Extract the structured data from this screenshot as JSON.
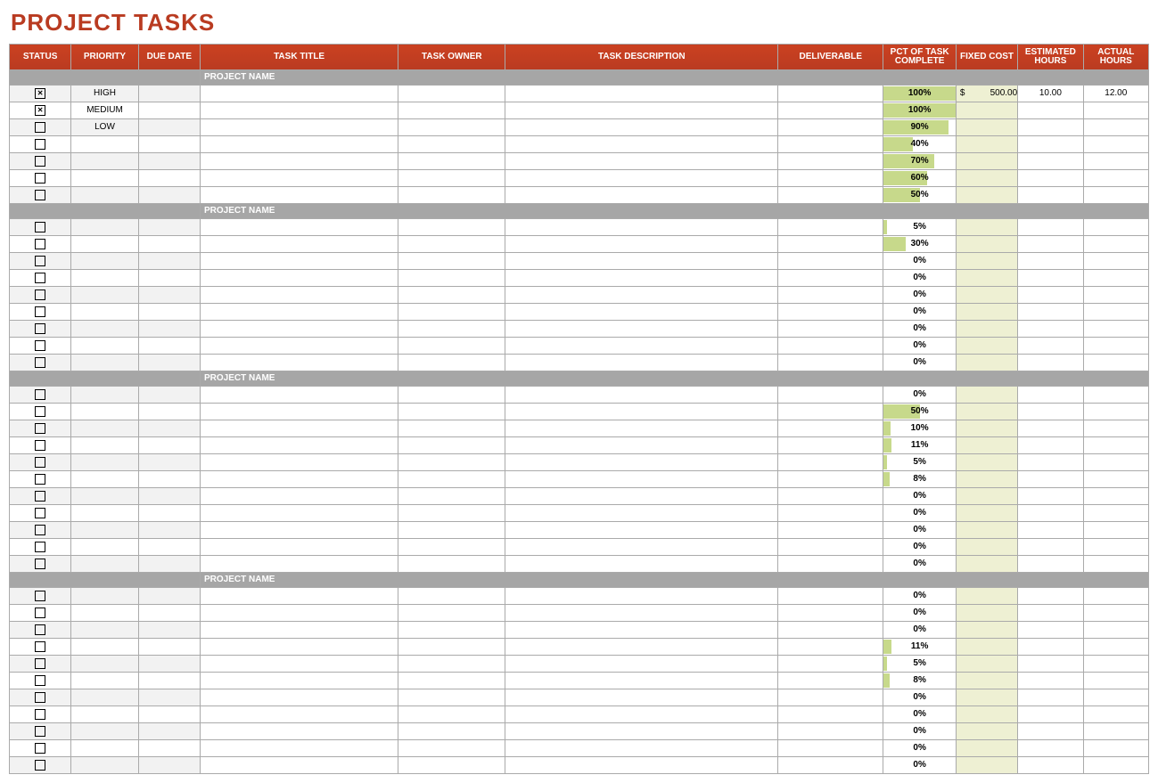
{
  "title": "PROJECT TASKS",
  "headers": {
    "status": "STATUS",
    "priority": "PRIORITY",
    "due_date": "DUE DATE",
    "task_title": "TASK TITLE",
    "task_owner": "TASK OWNER",
    "task_description": "TASK DESCRIPTION",
    "deliverable": "DELIVERABLE",
    "pct_complete": "PCT OF TASK COMPLETE",
    "fixed_cost": "FIXED COST",
    "est_hours": "ESTIMATED HOURS",
    "act_hours": "ACTUAL HOURS"
  },
  "section_label": "PROJECT NAME",
  "sections": [
    {
      "rows": [
        {
          "status_checked": true,
          "priority": "HIGH",
          "pct": 100,
          "fixed_cost": "500.00",
          "currency": "$",
          "est_hours": "10.00",
          "act_hours": "12.00"
        },
        {
          "status_checked": true,
          "priority": "MEDIUM",
          "pct": 100
        },
        {
          "status_checked": false,
          "priority": "LOW",
          "pct": 90
        },
        {
          "status_checked": false,
          "pct": 40
        },
        {
          "status_checked": false,
          "pct": 70
        },
        {
          "status_checked": false,
          "pct": 60
        },
        {
          "status_checked": false,
          "pct": 50
        }
      ]
    },
    {
      "rows": [
        {
          "status_checked": false,
          "pct": 5
        },
        {
          "status_checked": false,
          "pct": 30
        },
        {
          "status_checked": false,
          "pct": 0
        },
        {
          "status_checked": false,
          "pct": 0
        },
        {
          "status_checked": false,
          "pct": 0
        },
        {
          "status_checked": false,
          "pct": 0
        },
        {
          "status_checked": false,
          "pct": 0
        },
        {
          "status_checked": false,
          "pct": 0
        },
        {
          "status_checked": false,
          "pct": 0
        }
      ]
    },
    {
      "rows": [
        {
          "status_checked": false,
          "pct": 0
        },
        {
          "status_checked": false,
          "pct": 50
        },
        {
          "status_checked": false,
          "pct": 10
        },
        {
          "status_checked": false,
          "pct": 11
        },
        {
          "status_checked": false,
          "pct": 5
        },
        {
          "status_checked": false,
          "pct": 8
        },
        {
          "status_checked": false,
          "pct": 0
        },
        {
          "status_checked": false,
          "pct": 0
        },
        {
          "status_checked": false,
          "pct": 0
        },
        {
          "status_checked": false,
          "pct": 0
        },
        {
          "status_checked": false,
          "pct": 0
        }
      ]
    },
    {
      "rows": [
        {
          "status_checked": false,
          "pct": 0
        },
        {
          "status_checked": false,
          "pct": 0
        },
        {
          "status_checked": false,
          "pct": 0
        },
        {
          "status_checked": false,
          "pct": 11
        },
        {
          "status_checked": false,
          "pct": 5
        },
        {
          "status_checked": false,
          "pct": 8
        },
        {
          "status_checked": false,
          "pct": 0
        },
        {
          "status_checked": false,
          "pct": 0
        },
        {
          "status_checked": false,
          "pct": 0
        },
        {
          "status_checked": false,
          "pct": 0
        },
        {
          "status_checked": false,
          "pct": 0
        }
      ]
    }
  ]
}
